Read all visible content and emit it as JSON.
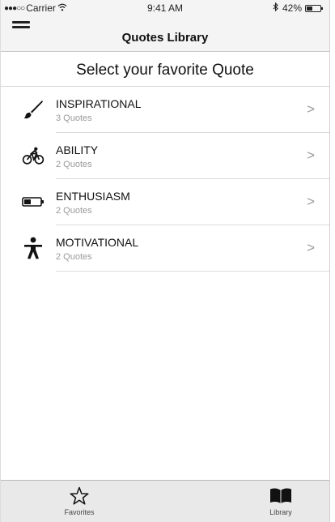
{
  "status_bar": {
    "carrier": "Carrier",
    "time": "9:41 AM",
    "battery": "42%"
  },
  "nav": {
    "title": "Quotes Library"
  },
  "heading": "Select your favorite Quote",
  "categories": [
    {
      "title": "INSPIRATIONAL",
      "subtitle": "3 Quotes",
      "icon": "paintbrush-icon"
    },
    {
      "title": "ABILITY",
      "subtitle": "2 Quotes",
      "icon": "cyclist-icon"
    },
    {
      "title": "ENTHUSIASM",
      "subtitle": "2 Quotes",
      "icon": "battery-low-icon"
    },
    {
      "title": "MOTIVATIONAL",
      "subtitle": "2 Quotes",
      "icon": "person-icon"
    }
  ],
  "chevron": ">",
  "tabs": {
    "favorites": {
      "label": "Favorites",
      "icon": "star-outline-icon"
    },
    "library": {
      "label": "Library",
      "icon": "book-icon"
    }
  },
  "colors": {
    "chrome_bg": "#f4f4f4",
    "tab_bar_bg": "#e9e9e9",
    "subtitle_gray": "#9a9a9a",
    "separator": "#dadada"
  }
}
